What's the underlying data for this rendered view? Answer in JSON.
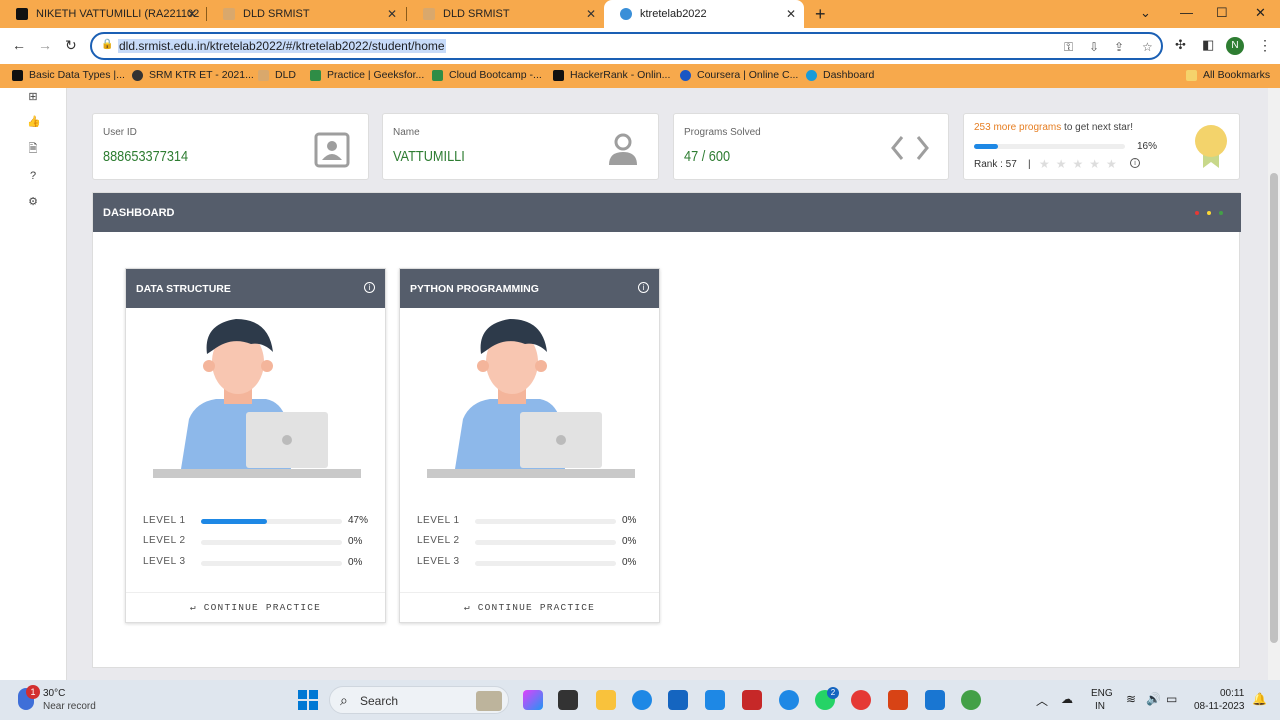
{
  "browser": {
    "tabs": [
      {
        "title": "NIKETH VATTUMILLI (RA221102",
        "favicon_color": "#111111"
      },
      {
        "title": "DLD SRMIST",
        "favicon_color": "#d9a86c"
      },
      {
        "title": "DLD SRMIST",
        "favicon_color": "#d9a86c"
      },
      {
        "title": "ktretelab2022",
        "favicon_color": "#3a8fd8"
      }
    ],
    "url": "dld.srmist.edu.in/ktretelab2022/#/ktretelab2022/student/home",
    "bookmarks": [
      "Basic Data Types |...",
      "SRM KTR ET - 2021...",
      "DLD",
      "Practice | Geeksfor...",
      "Cloud Bootcamp -...",
      "HackerRank - Onlin...",
      "Coursera | Online C...",
      "Dashboard"
    ],
    "all_bookmarks": "All Bookmarks",
    "profile_initial": "N"
  },
  "stats": {
    "user_id_label": "User ID",
    "user_id": "888653377314",
    "name_label": "Name",
    "name": "VATTUMILLI",
    "solved_label": "Programs Solved",
    "solved": "47 / 600",
    "next_count": "253 more programs",
    "next_text": "to get next star!",
    "progress_pct": "16%",
    "progress_value": 0.16,
    "rank": "Rank : 57",
    "stars_filled": 0,
    "stars_total": 5
  },
  "dashboard": {
    "title": "DASHBOARD",
    "dots": [
      "#e53935",
      "#fdd835",
      "#43a047"
    ],
    "courses": [
      {
        "title": "DATA STRUCTURE",
        "levels": [
          {
            "label": "LEVEL 1",
            "pct": "47%",
            "value": 0.47
          },
          {
            "label": "LEVEL 2",
            "pct": "0%",
            "value": 0
          },
          {
            "label": "LEVEL 3",
            "pct": "0%",
            "value": 0
          }
        ],
        "button": "CONTINUE PRACTICE"
      },
      {
        "title": "PYTHON PROGRAMMING",
        "levels": [
          {
            "label": "LEVEL 1",
            "pct": "0%",
            "value": 0
          },
          {
            "label": "LEVEL 2",
            "pct": "0%",
            "value": 0
          },
          {
            "label": "LEVEL 3",
            "pct": "0%",
            "value": 0
          }
        ],
        "button": "CONTINUE PRACTICE"
      }
    ]
  },
  "taskbar": {
    "temp": "30°C",
    "weather": "Near record",
    "search": "Search",
    "lang1": "ENG",
    "lang2": "IN",
    "time": "00:11",
    "date": "08-11-2023",
    "weather_badge": "1",
    "whatsapp_badge": "2"
  }
}
